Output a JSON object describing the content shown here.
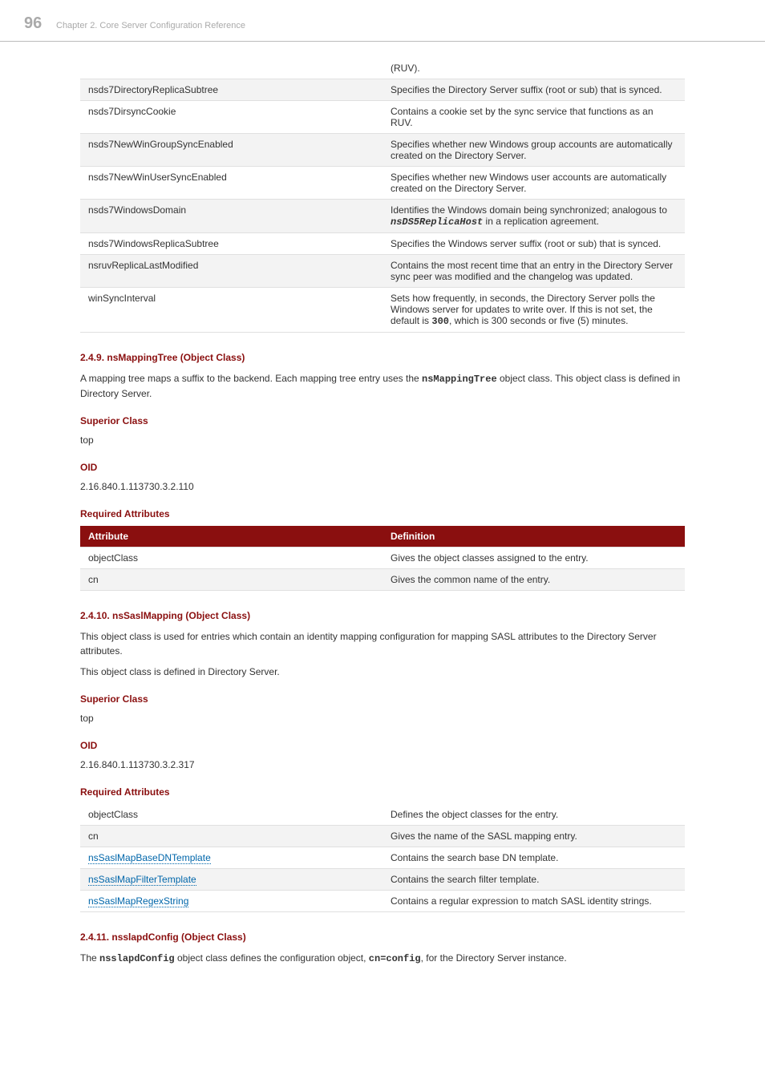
{
  "header": {
    "page_number": "96",
    "chapter": "Chapter 2. Core Server Configuration Reference"
  },
  "table1": {
    "rows": [
      {
        "attr": "",
        "def": "(RUV)."
      },
      {
        "attr": "nsds7DirectoryReplicaSubtree",
        "def": "Specifies the Directory Server suffix (root or sub) that is synced."
      },
      {
        "attr": "nsds7DirsyncCookie",
        "def": "Contains a cookie set by the sync service that functions as an RUV."
      },
      {
        "attr": "nsds7NewWinGroupSyncEnabled",
        "def": "Specifies whether new Windows group accounts are automatically created on the Directory Server."
      },
      {
        "attr": "nsds7NewWinUserSyncEnabled",
        "def": "Specifies whether new Windows user accounts are automatically created on the Directory Server."
      },
      {
        "attr": "nsds7WindowsDomain",
        "def_pre": "Identifies the Windows domain being synchronized; analogous to ",
        "def_mono": "nsDS5ReplicaHost",
        "def_post": " in a replication agreement."
      },
      {
        "attr": "nsds7WindowsReplicaSubtree",
        "def": "Specifies the Windows server suffix (root or sub) that is synced."
      },
      {
        "attr": "nsruvReplicaLastModified",
        "def": "Contains the most recent time that an entry in the Directory Server sync peer was modified and the changelog was updated."
      },
      {
        "attr": "winSyncInterval",
        "def_pre": "Sets how frequently, in seconds, the Directory Server polls the Windows server for updates to write over. If this is not set, the default is ",
        "def_mono2": "300",
        "def_post2": ", which is 300 seconds or five (5) minutes."
      }
    ]
  },
  "sec249": {
    "heading": "2.4.9. nsMappingTree (Object Class)",
    "para_pre": "A mapping tree maps a suffix to the backend. Each mapping tree entry uses the ",
    "para_mono": "nsMappingTree",
    "para_post": " object class. This object class is defined in Directory Server.",
    "superior_label": "Superior Class",
    "superior_value": "top",
    "oid_label": "OID",
    "oid_value": "2.16.840.1.113730.3.2.110",
    "req_label": "Required Attributes",
    "th_attr": "Attribute",
    "th_def": "Definition",
    "rows": [
      {
        "attr": "objectClass",
        "def": "Gives the object classes assigned to the entry."
      },
      {
        "attr": "cn",
        "def": "Gives the common name of the entry."
      }
    ]
  },
  "sec2410": {
    "heading": "2.4.10. nsSaslMapping (Object Class)",
    "para1": "This object class is used for entries which contain an identity mapping configuration for mapping SASL attributes to the Directory Server attributes.",
    "para2": "This object class is defined in Directory Server.",
    "superior_label": "Superior Class",
    "superior_value": "top",
    "oid_label": "OID",
    "oid_value": "2.16.840.1.113730.3.2.317",
    "req_label": "Required Attributes",
    "rows": [
      {
        "attr": "objectClass",
        "def": "Defines the object classes for the entry."
      },
      {
        "attr": "cn",
        "def": "Gives the name of the SASL mapping entry."
      },
      {
        "attr": "nsSaslMapBaseDNTemplate",
        "def": "Contains the search base DN template."
      },
      {
        "attr": "nsSaslMapFilterTemplate",
        "def": "Contains the search filter template."
      },
      {
        "attr": "nsSaslMapRegexString",
        "def": "Contains a regular expression to match SASL identity strings."
      }
    ]
  },
  "sec2411": {
    "heading": "2.4.11. nsslapdConfig (Object Class)",
    "para_pre": "The ",
    "para_mono1": "nsslapdConfig",
    "para_mid": " object class defines the configuration object, ",
    "para_mono2": "cn=config",
    "para_post": ", for the Directory Server instance."
  }
}
